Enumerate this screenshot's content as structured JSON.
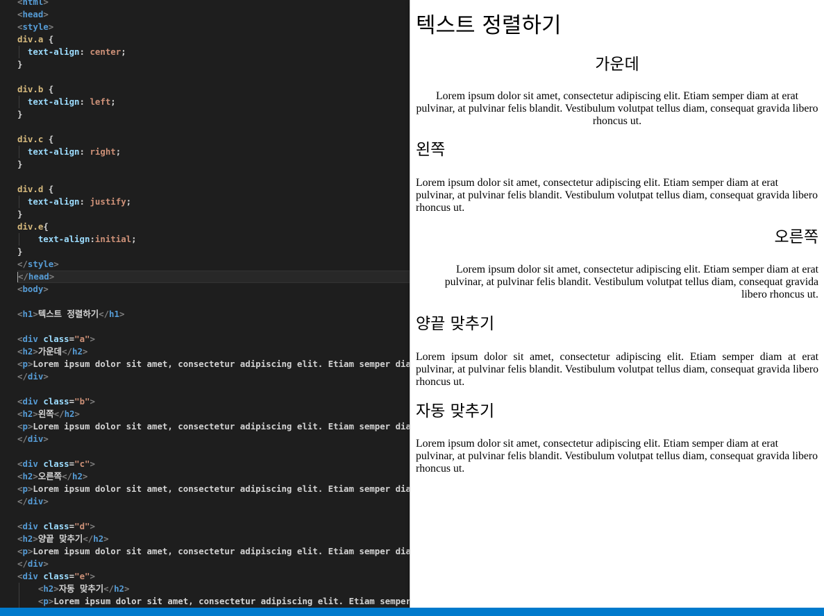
{
  "editor": {
    "lines": [
      [
        [
          "tk-br",
          "<"
        ],
        [
          "tk-tag",
          "html"
        ],
        [
          "tk-br",
          ">"
        ]
      ],
      [
        [
          "tk-br",
          "<"
        ],
        [
          "tk-tag",
          "head"
        ],
        [
          "tk-br",
          ">"
        ]
      ],
      [
        [
          "tk-br",
          "<"
        ],
        [
          "tk-tag",
          "style"
        ],
        [
          "tk-br",
          ">"
        ]
      ],
      [
        [
          "tk-sel",
          "div.a"
        ],
        [
          "tk-pun",
          " {"
        ]
      ],
      [
        [
          "tk-pun",
          "  "
        ],
        [
          "tk-prop",
          "text-align"
        ],
        [
          "tk-pun",
          ": "
        ],
        [
          "tk-val",
          "center"
        ],
        [
          "tk-pun",
          ";"
        ]
      ],
      [
        [
          "tk-pun",
          "}"
        ]
      ],
      [],
      [
        [
          "tk-sel",
          "div.b"
        ],
        [
          "tk-pun",
          " {"
        ]
      ],
      [
        [
          "tk-pun",
          "  "
        ],
        [
          "tk-prop",
          "text-align"
        ],
        [
          "tk-pun",
          ": "
        ],
        [
          "tk-val",
          "left"
        ],
        [
          "tk-pun",
          ";"
        ]
      ],
      [
        [
          "tk-pun",
          "}"
        ]
      ],
      [],
      [
        [
          "tk-sel",
          "div.c"
        ],
        [
          "tk-pun",
          " {"
        ]
      ],
      [
        [
          "tk-pun",
          "  "
        ],
        [
          "tk-prop",
          "text-align"
        ],
        [
          "tk-pun",
          ": "
        ],
        [
          "tk-val",
          "right"
        ],
        [
          "tk-pun",
          ";"
        ]
      ],
      [
        [
          "tk-pun",
          "}"
        ]
      ],
      [],
      [
        [
          "tk-sel",
          "div.d"
        ],
        [
          "tk-pun",
          " {"
        ]
      ],
      [
        [
          "tk-pun",
          "  "
        ],
        [
          "tk-prop",
          "text-align"
        ],
        [
          "tk-pun",
          ": "
        ],
        [
          "tk-val",
          "justify"
        ],
        [
          "tk-pun",
          ";"
        ]
      ],
      [
        [
          "tk-pun",
          "}"
        ]
      ],
      [
        [
          "tk-sel",
          "div.e"
        ],
        [
          "tk-pun",
          "{"
        ]
      ],
      [
        [
          "tk-pun",
          "    "
        ],
        [
          "tk-prop",
          "text-align"
        ],
        [
          "tk-pun",
          ":"
        ],
        [
          "tk-val",
          "initial"
        ],
        [
          "tk-pun",
          ";"
        ]
      ],
      [
        [
          "tk-pun",
          "}"
        ]
      ],
      [
        [
          "tk-br",
          "</"
        ],
        [
          "tk-tag",
          "style"
        ],
        [
          "tk-br",
          ">"
        ]
      ],
      [
        [
          "tk-br",
          "</"
        ],
        [
          "tk-tag",
          "head"
        ],
        [
          "tk-br",
          ">"
        ]
      ],
      [
        [
          "tk-br",
          "<"
        ],
        [
          "tk-tag",
          "body"
        ],
        [
          "tk-br",
          ">"
        ]
      ],
      [],
      [
        [
          "tk-br",
          "<"
        ],
        [
          "tk-tag",
          "h1"
        ],
        [
          "tk-br",
          ">"
        ],
        [
          "tk-txt",
          "텍스트 정렬하기"
        ],
        [
          "tk-br",
          "</"
        ],
        [
          "tk-tag",
          "h1"
        ],
        [
          "tk-br",
          ">"
        ]
      ],
      [],
      [
        [
          "tk-br",
          "<"
        ],
        [
          "tk-tag",
          "div"
        ],
        [
          "tk-pun",
          " "
        ],
        [
          "tk-attr",
          "class"
        ],
        [
          "tk-pun",
          "="
        ],
        [
          "tk-str",
          "\"a\""
        ],
        [
          "tk-br",
          ">"
        ]
      ],
      [
        [
          "tk-br",
          "<"
        ],
        [
          "tk-tag",
          "h2"
        ],
        [
          "tk-br",
          ">"
        ],
        [
          "tk-txt",
          "가운데"
        ],
        [
          "tk-br",
          "</"
        ],
        [
          "tk-tag",
          "h2"
        ],
        [
          "tk-br",
          ">"
        ]
      ],
      [
        [
          "tk-br",
          "<"
        ],
        [
          "tk-tag",
          "p"
        ],
        [
          "tk-br",
          ">"
        ],
        [
          "tk-txt",
          "Lorem ipsum dolor sit amet, consectetur adipiscing elit. Etiam semper diam at erat"
        ]
      ],
      [
        [
          "tk-br",
          "</"
        ],
        [
          "tk-tag",
          "div"
        ],
        [
          "tk-br",
          ">"
        ]
      ],
      [],
      [
        [
          "tk-br",
          "<"
        ],
        [
          "tk-tag",
          "div"
        ],
        [
          "tk-pun",
          " "
        ],
        [
          "tk-attr",
          "class"
        ],
        [
          "tk-pun",
          "="
        ],
        [
          "tk-str",
          "\"b\""
        ],
        [
          "tk-br",
          ">"
        ]
      ],
      [
        [
          "tk-br",
          "<"
        ],
        [
          "tk-tag",
          "h2"
        ],
        [
          "tk-br",
          ">"
        ],
        [
          "tk-txt",
          "왼쪽"
        ],
        [
          "tk-br",
          "</"
        ],
        [
          "tk-tag",
          "h2"
        ],
        [
          "tk-br",
          ">"
        ]
      ],
      [
        [
          "tk-br",
          "<"
        ],
        [
          "tk-tag",
          "p"
        ],
        [
          "tk-br",
          ">"
        ],
        [
          "tk-txt",
          "Lorem ipsum dolor sit amet, consectetur adipiscing elit. Etiam semper diam at erat"
        ]
      ],
      [
        [
          "tk-br",
          "</"
        ],
        [
          "tk-tag",
          "div"
        ],
        [
          "tk-br",
          ">"
        ]
      ],
      [],
      [
        [
          "tk-br",
          "<"
        ],
        [
          "tk-tag",
          "div"
        ],
        [
          "tk-pun",
          " "
        ],
        [
          "tk-attr",
          "class"
        ],
        [
          "tk-pun",
          "="
        ],
        [
          "tk-str",
          "\"c\""
        ],
        [
          "tk-br",
          ">"
        ]
      ],
      [
        [
          "tk-br",
          "<"
        ],
        [
          "tk-tag",
          "h2"
        ],
        [
          "tk-br",
          ">"
        ],
        [
          "tk-txt",
          "오른쪽"
        ],
        [
          "tk-br",
          "</"
        ],
        [
          "tk-tag",
          "h2"
        ],
        [
          "tk-br",
          ">"
        ]
      ],
      [
        [
          "tk-br",
          "<"
        ],
        [
          "tk-tag",
          "p"
        ],
        [
          "tk-br",
          ">"
        ],
        [
          "tk-txt",
          "Lorem ipsum dolor sit amet, consectetur adipiscing elit. Etiam semper diam at erat"
        ]
      ],
      [
        [
          "tk-br",
          "</"
        ],
        [
          "tk-tag",
          "div"
        ],
        [
          "tk-br",
          ">"
        ]
      ],
      [],
      [
        [
          "tk-br",
          "<"
        ],
        [
          "tk-tag",
          "div"
        ],
        [
          "tk-pun",
          " "
        ],
        [
          "tk-attr",
          "class"
        ],
        [
          "tk-pun",
          "="
        ],
        [
          "tk-str",
          "\"d\""
        ],
        [
          "tk-br",
          ">"
        ]
      ],
      [
        [
          "tk-br",
          "<"
        ],
        [
          "tk-tag",
          "h2"
        ],
        [
          "tk-br",
          ">"
        ],
        [
          "tk-txt",
          "양끝 맞추기"
        ],
        [
          "tk-br",
          "</"
        ],
        [
          "tk-tag",
          "h2"
        ],
        [
          "tk-br",
          ">"
        ]
      ],
      [
        [
          "tk-br",
          "<"
        ],
        [
          "tk-tag",
          "p"
        ],
        [
          "tk-br",
          ">"
        ],
        [
          "tk-txt",
          "Lorem ipsum dolor sit amet, consectetur adipiscing elit. Etiam semper diam at erat"
        ]
      ],
      [
        [
          "tk-br",
          "</"
        ],
        [
          "tk-tag",
          "div"
        ],
        [
          "tk-br",
          ">"
        ]
      ],
      [
        [
          "tk-br",
          "<"
        ],
        [
          "tk-tag",
          "div"
        ],
        [
          "tk-pun",
          " "
        ],
        [
          "tk-attr",
          "class"
        ],
        [
          "tk-pun",
          "="
        ],
        [
          "tk-str",
          "\"e\""
        ],
        [
          "tk-br",
          ">"
        ]
      ],
      [
        [
          "tk-pun",
          "    "
        ],
        [
          "tk-br",
          "<"
        ],
        [
          "tk-tag",
          "h2"
        ],
        [
          "tk-br",
          ">"
        ],
        [
          "tk-txt",
          "자동 맞추기"
        ],
        [
          "tk-br",
          "</"
        ],
        [
          "tk-tag",
          "h2"
        ],
        [
          "tk-br",
          ">"
        ]
      ],
      [
        [
          "tk-pun",
          "    "
        ],
        [
          "tk-br",
          "<"
        ],
        [
          "tk-tag",
          "p"
        ],
        [
          "tk-br",
          ">"
        ],
        [
          "tk-txt",
          "Lorem ipsum dolor sit amet, consectetur adipiscing elit. Etiam semper diam at erat"
        ]
      ]
    ],
    "current_line": 22
  },
  "preview": {
    "title": "텍스트 정렬하기",
    "sections": [
      {
        "heading": "가운데",
        "align": "center",
        "text": "Lorem ipsum dolor sit amet, consectetur adipiscing elit. Etiam semper diam at erat pulvinar, at pulvinar felis blandit. Vestibulum volutpat tellus diam, consequat gravida libero rhoncus ut."
      },
      {
        "heading": "왼쪽",
        "align": "left",
        "text": "Lorem ipsum dolor sit amet, consectetur adipiscing elit. Etiam semper diam at erat pulvinar, at pulvinar felis blandit. Vestibulum volutpat tellus diam, consequat gravida libero rhoncus ut."
      },
      {
        "heading": "오른쪽",
        "align": "right",
        "text": "Lorem ipsum dolor sit amet, consectetur adipiscing elit. Etiam semper diam at erat pulvinar, at pulvinar felis blandit. Vestibulum volutpat tellus diam, consequat gravida libero rhoncus ut."
      },
      {
        "heading": "양끝 맞추기",
        "align": "justify",
        "text": "Lorem ipsum dolor sit amet, consectetur adipiscing elit. Etiam semper diam at erat pulvinar, at pulvinar felis blandit. Vestibulum volutpat tellus diam, consequat gravida libero rhoncus ut."
      },
      {
        "heading": "자동 맞추기",
        "align": "initial",
        "text": "Lorem ipsum dolor sit amet, consectetur adipiscing elit. Etiam semper diam at erat pulvinar, at pulvinar felis blandit. Vestibulum volutpat tellus diam, consequat gravida libero rhoncus ut."
      }
    ]
  },
  "colors": {
    "editor_bg": "#1e1e1e",
    "statusbar": "#007acc",
    "tag": "#569cd6",
    "string": "#ce9178",
    "property": "#9cdcfe",
    "selector": "#d7ba7d"
  }
}
